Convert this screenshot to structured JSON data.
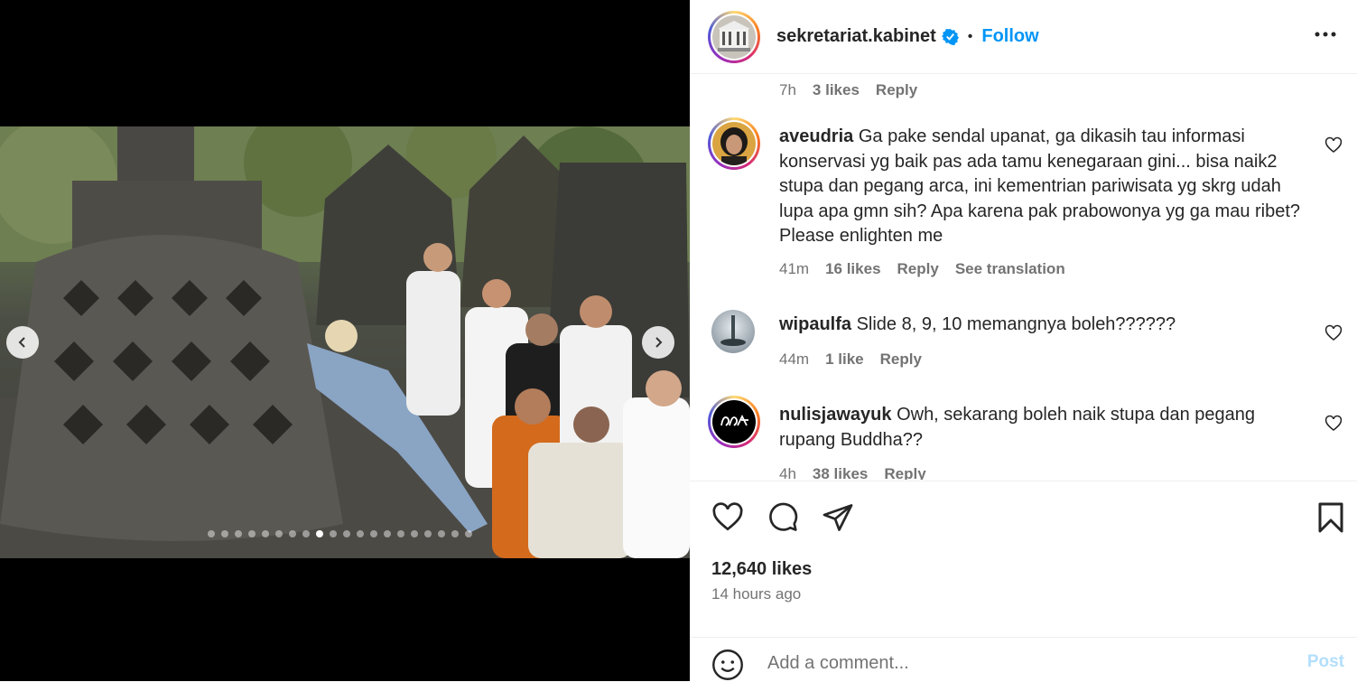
{
  "post": {
    "username": "sekretariat.kabinet",
    "follow_label": "Follow",
    "separator": "•",
    "likes": "12,640 likes",
    "time_ago": "14 hours ago",
    "carousel": {
      "total_slides": 20,
      "active_slide": 9
    }
  },
  "comments": [
    {
      "meta_time": "7h",
      "meta_likes": "3 likes",
      "reply": "Reply"
    },
    {
      "user": "aveudria",
      "text": "Ga pake sendal upanat, ga dikasih tau informasi konservasi yg baik pas ada tamu kenegaraan gini... bisa naik2 stupa dan pegang arca, ini kementrian pariwisata yg skrg udah lupa apa gmn sih? Apa karena pak prabowonya yg ga mau ribet? Please enlighten me",
      "meta_time": "41m",
      "meta_likes": "16 likes",
      "reply": "Reply",
      "translate": "See translation"
    },
    {
      "user": "wipaulfa",
      "text": "Slide 8, 9, 10 memangnya boleh??????",
      "meta_time": "44m",
      "meta_likes": "1 like",
      "reply": "Reply"
    },
    {
      "user": "nulisjawayuk",
      "text": "Owh, sekarang boleh naik stupa dan pegang rupang Buddha??",
      "meta_time": "4h",
      "meta_likes": "38 likes",
      "reply": "Reply"
    }
  ],
  "comment_box": {
    "placeholder": "Add a comment...",
    "post_label": "Post"
  },
  "colors": {
    "link": "#0095f6",
    "muted": "#737373",
    "text": "#262626"
  },
  "icons": [
    "chevron-left-icon",
    "chevron-right-icon",
    "verified-icon",
    "more-icon",
    "heart-icon",
    "comment-icon",
    "share-icon",
    "bookmark-icon",
    "emoji-icon"
  ]
}
